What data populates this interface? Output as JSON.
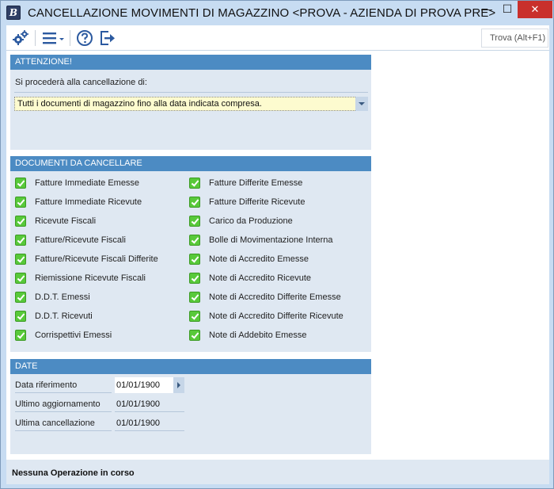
{
  "window": {
    "title": "CANCELLAZIONE MOVIMENTI DI MAGAZZINO <PROVA - AZIENDA DI PROVA PRE>",
    "app_icon_letter": "B",
    "minimize": "—",
    "maximize": "☐",
    "close": "✕"
  },
  "toolbar": {
    "search_placeholder": "Trova (Alt+F1)",
    "icons": [
      "gears-icon",
      "menu-icon",
      "help-icon",
      "exit-icon"
    ]
  },
  "attenzione": {
    "header": "ATTENZIONE!",
    "label": "Si procederà alla cancellazione di:",
    "selected": "Tutti i documenti di magazzino fino alla data indicata compresa."
  },
  "documenti": {
    "header": "DOCUMENTI DA CANCELLARE",
    "left": [
      {
        "label": "Fatture Immediate Emesse",
        "checked": true
      },
      {
        "label": "Fatture Immediate Ricevute",
        "checked": true
      },
      {
        "label": "Ricevute Fiscali",
        "checked": true
      },
      {
        "label": "Fatture/Ricevute Fiscali",
        "checked": true
      },
      {
        "label": "Fatture/Ricevute Fiscali Differite",
        "checked": true
      },
      {
        "label": "Riemissione Ricevute Fiscali",
        "checked": true
      },
      {
        "label": "D.D.T. Emessi",
        "checked": true
      },
      {
        "label": "D.D.T. Ricevuti",
        "checked": true
      },
      {
        "label": "Corrispettivi Emessi",
        "checked": true
      }
    ],
    "right": [
      {
        "label": "Fatture Differite Emesse",
        "checked": true
      },
      {
        "label": "Fatture Differite Ricevute",
        "checked": true
      },
      {
        "label": "Carico da Produzione",
        "checked": true
      },
      {
        "label": "Bolle di Movimentazione Interna",
        "checked": true
      },
      {
        "label": "Note di Accredito Emesse",
        "checked": true
      },
      {
        "label": "Note di Accredito Ricevute",
        "checked": true
      },
      {
        "label": "Note di Accredito Differite Emesse",
        "checked": true
      },
      {
        "label": "Note di Accredito Differite Ricevute",
        "checked": true
      },
      {
        "label": "Note di Addebito Emesse",
        "checked": true
      }
    ]
  },
  "date": {
    "header": "DATE",
    "riferimento_label": "Data riferimento",
    "riferimento_value": "01/01/1900",
    "aggiornamento_label": "Ultimo aggiornamento",
    "aggiornamento_value": "01/01/1900",
    "cancellazione_label": "Ultima cancellazione",
    "cancellazione_value": "01/01/1900"
  },
  "status": {
    "text": "Nessuna Operazione in corso"
  },
  "colors": {
    "window_frame": "#c7dcf2",
    "panel_header": "#4c8bc3",
    "panel_bg": "#dfe8f2",
    "checkbox_green": "#58c93a",
    "select_bg": "#fdfbcf",
    "close_red": "#c9302c"
  }
}
